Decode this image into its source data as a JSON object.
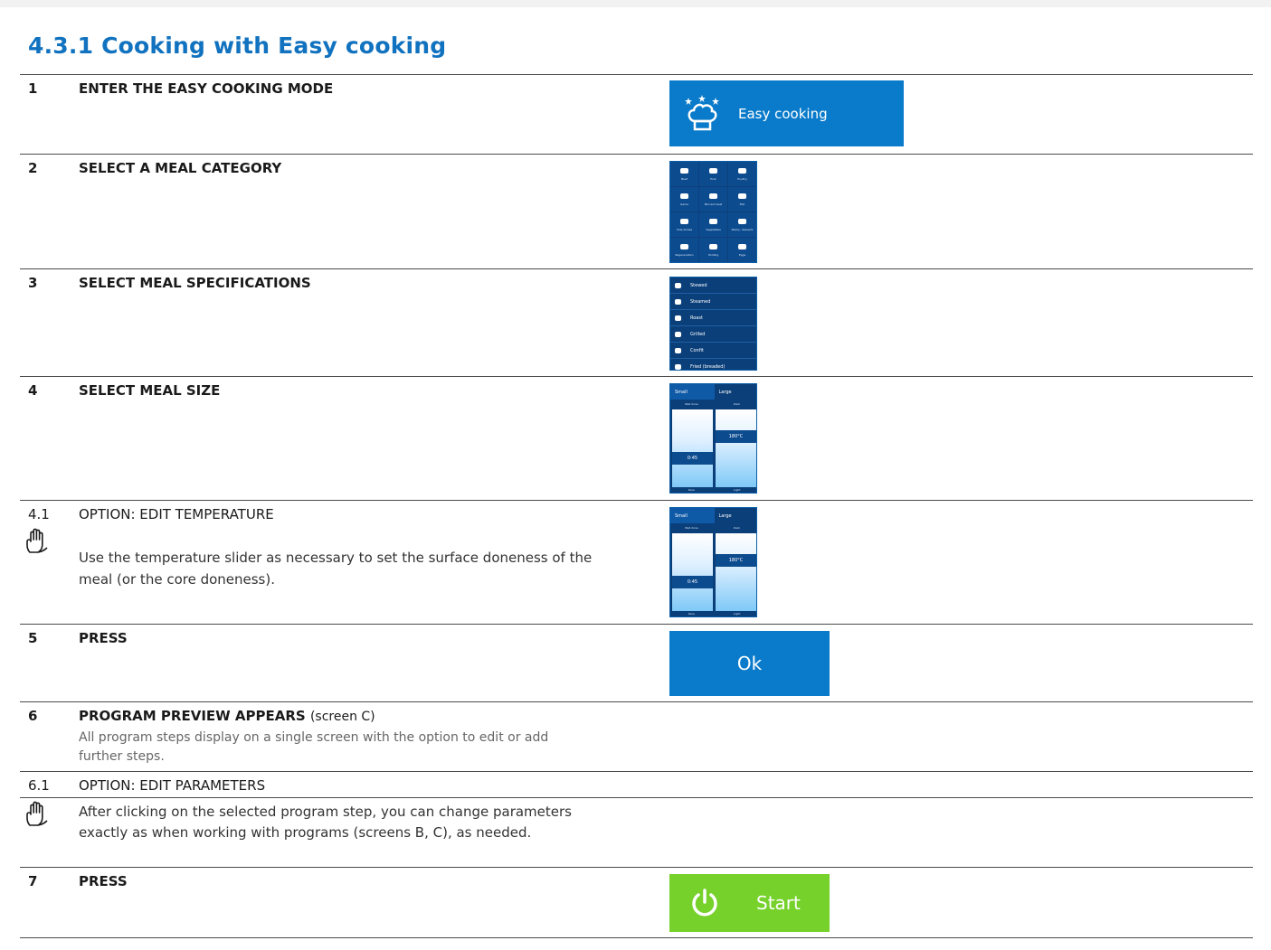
{
  "title": "4.3.1   Cooking with Easy cooking",
  "steps": [
    {
      "num": "1",
      "heading": "ENTER THE EASY COOKING MODE"
    },
    {
      "num": "2",
      "heading": "SELECT A MEAL CATEGORY"
    },
    {
      "num": "3",
      "heading": "SELECT MEAL SPECIFICATIONS"
    },
    {
      "num": "4",
      "heading": "SELECT MEAL SIZE"
    },
    {
      "num": "4.1",
      "heading": "OPTION: EDIT TEMPERATURE",
      "body": "Use the temperature slider as necessary to set the surface doneness of the meal (or the core doneness)."
    },
    {
      "num": "5",
      "heading": "PRESS"
    },
    {
      "num": "6",
      "heading": "PROGRAM PREVIEW APPEARS",
      "note": "(screen C)",
      "body": "All program steps display on a single screen with the option to edit or add further steps."
    },
    {
      "num": "6.1",
      "heading": "OPTION: EDIT PARAMETERS",
      "body": "After clicking on the selected program step, you can change parameters exactly as when working with programs (screens B, C), as needed."
    },
    {
      "num": "7",
      "heading": "PRESS"
    }
  ],
  "easy_button": {
    "label": "Easy cooking",
    "icon": "chef-hat-stars-icon"
  },
  "categories": [
    "Beef",
    "Pork",
    "Poultry",
    "Game",
    "Minced meat",
    "Fish",
    "Side dishes",
    "Vegetables",
    "Pastry, desserts",
    "Regeneration",
    "Holding",
    "Eggs"
  ],
  "specifications": [
    "Stewed",
    "Steamed",
    "Roast",
    "Grilled",
    "Confit",
    "Fried (breaded)"
  ],
  "size_screen": {
    "small": "Small",
    "large": "Large",
    "left_top": "Well done",
    "right_top": "Dark",
    "time": "0:45",
    "temp": "180°C",
    "left_bottom": "Rare",
    "right_bottom": "Light"
  },
  "ok_button": {
    "label": "Ok"
  },
  "start_button": {
    "label": "Start",
    "icon": "power-icon"
  },
  "colors": {
    "accent": "#1172bf",
    "button_blue": "#0a7bca",
    "start_green": "#76d12b",
    "screen_bg": "#0b3f7a"
  }
}
